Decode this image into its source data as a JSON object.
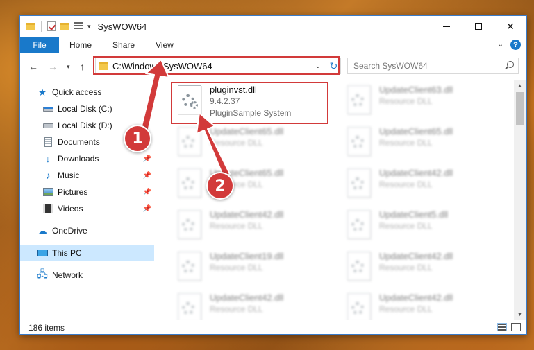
{
  "window": {
    "title": "SysWOW64"
  },
  "ribbon": {
    "tabs": [
      "File",
      "Home",
      "Share",
      "View"
    ],
    "help": "?"
  },
  "navbar": {
    "address": "C:\\Windows\\SysWOW64",
    "search_placeholder": "Search SysWOW64"
  },
  "sidebar": {
    "items": [
      {
        "label": "Quick access"
      },
      {
        "label": "Local Disk (C:)"
      },
      {
        "label": "Local Disk (D:)"
      },
      {
        "label": "Documents"
      },
      {
        "label": "Downloads"
      },
      {
        "label": "Music"
      },
      {
        "label": "Pictures"
      },
      {
        "label": "Videos"
      },
      {
        "label": "OneDrive"
      },
      {
        "label": "This PC"
      },
      {
        "label": "Network"
      }
    ],
    "selected": "This PC"
  },
  "files": {
    "highlighted": {
      "name": "pluginvst.dll",
      "version": "9.4.2.37",
      "description": "PluginSample System"
    },
    "blurred": [
      {
        "name": "UpdateClient63.dll",
        "type": "Resource DLL"
      },
      {
        "name": "UpdateClient65.dll",
        "type": "Resource DLL"
      },
      {
        "name": "UpdateClient65.dll",
        "type": "Resource DLL"
      },
      {
        "name": "UpdateClient65.dll",
        "type": "Resource DLL"
      },
      {
        "name": "UpdateClient42.dll",
        "type": "Resource DLL"
      },
      {
        "name": "UpdateClient42.dll",
        "type": "Resource DLL"
      },
      {
        "name": "UpdateClient5.dll",
        "type": "Resource DLL"
      },
      {
        "name": "UpdateClient19.dll",
        "type": "Resource DLL"
      },
      {
        "name": "UpdateClient42.dll",
        "type": "Resource DLL"
      },
      {
        "name": "UpdateClient42.dll",
        "type": "Resource DLL"
      },
      {
        "name": "UpdateClient42.dll",
        "type": "Resource DLL"
      }
    ]
  },
  "status": {
    "item_count": "186 items"
  },
  "callouts": [
    "1",
    "2"
  ],
  "colors": {
    "accent": "#1979ca",
    "highlight": "#d23a3a",
    "selected_bg": "#cce8ff"
  }
}
